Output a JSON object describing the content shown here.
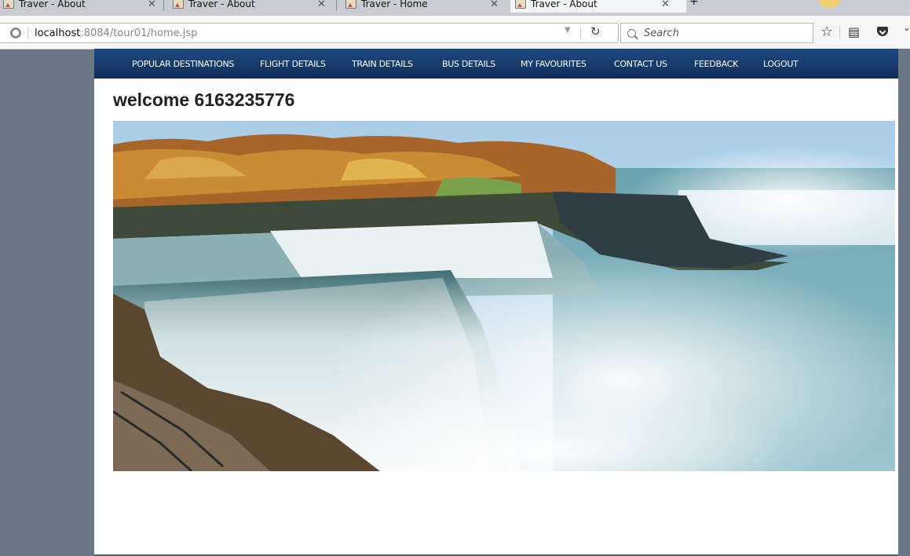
{
  "browser": {
    "tabs": [
      {
        "title": "Traver - About"
      },
      {
        "title": "Traver - About"
      },
      {
        "title": "Traver - Home"
      },
      {
        "title": "Traver - About"
      }
    ],
    "new_tab": "+",
    "url_host": "localhost",
    "url_rest": ":8084/tour01/home.jsp",
    "search_placeholder": "Search"
  },
  "menu": {
    "items": [
      {
        "label": "POPULAR DESTINATIONS"
      },
      {
        "label": "FLIGHT DETAILS"
      },
      {
        "label": "TRAIN DETAILS"
      },
      {
        "label": "BUS DETAILS"
      },
      {
        "label": "MY FAVOURITES"
      },
      {
        "label": "CONTACT US"
      },
      {
        "label": "FEEDBACK"
      },
      {
        "label": "LOGOUT"
      }
    ]
  },
  "main": {
    "welcome": "welcome 6163235776"
  },
  "colors": {
    "menu_bg": "#1a3f73",
    "page_bg": "#6a7686"
  }
}
